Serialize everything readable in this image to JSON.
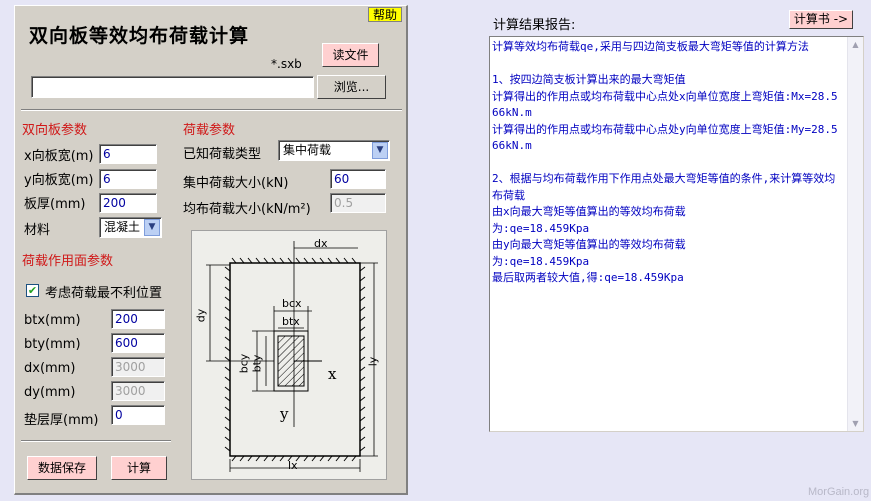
{
  "help_label": "帮助",
  "app_title": "双向板等效均布荷载计算",
  "file": {
    "extension": "*.sxb",
    "read_button": "读文件",
    "browse_button": "浏览...",
    "path_value": ""
  },
  "plate_params": {
    "title": "双向板参数",
    "x_width_label": "x向板宽(m)",
    "x_width_value": "6",
    "y_width_label": "y向板宽(m)",
    "y_width_value": "6",
    "thickness_label": "板厚(mm)",
    "thickness_value": "200",
    "material_label": "材料",
    "material_value": "混凝土"
  },
  "load_params": {
    "title": "荷载参数",
    "known_type_label": "已知荷载类型",
    "known_type_value": "集中荷载",
    "concentrated_label": "集中荷载大小(kN)",
    "concentrated_value": "60",
    "distributed_label": "均布荷载大小(kN/m²)",
    "distributed_value": "0.5"
  },
  "surface_params": {
    "title": "荷载作用面参数",
    "worst_position_label": "考虑荷载最不利位置",
    "worst_position_checked": true,
    "btx_label": "btx(mm)",
    "btx_value": "200",
    "bty_label": "bty(mm)",
    "bty_value": "600",
    "dx_label": "dx(mm)",
    "dx_value": "3000",
    "dy_label": "dy(mm)",
    "dy_value": "3000",
    "cushion_label": "垫层厚(mm)",
    "cushion_value": "0"
  },
  "diagram": {
    "dx": "dx",
    "dy": "dy",
    "bcx": "bcx",
    "btx": "btx",
    "bcy": "bcy",
    "bty": "bty",
    "lx": "lx",
    "ly": "ly",
    "x": "x",
    "y": "y"
  },
  "buttons": {
    "save": "数据保存",
    "calc": "计算"
  },
  "report": {
    "label": "计算结果报告:",
    "book_button": "计算书 ->",
    "text": "计算等效均布荷载qe,采用与四边简支板最大弯矩等值的计算方法\n\n1、按四边简支板计算出来的最大弯矩值\n计算得出的作用点或均布荷载中心点处x向单位宽度上弯矩值:Mx=28.566kN.m\n计算得出的作用点或均布荷载中心点处y向单位宽度上弯矩值:My=28.566kN.m\n\n2、根据与均布荷载作用下作用点处最大弯矩等值的条件,来计算等效均布荷载\n由x向最大弯矩等值算出的等效均布荷载\n为:qe=18.459Kpa\n由y向最大弯矩等值算出的等效均布荷载\n为:qe=18.459Kpa\n最后取两者较大值,得:qe=18.459Kpa"
  },
  "watermark": "MorGain.org",
  "colors": {
    "section_title": "#d01818",
    "input_text": "#0000a0",
    "report_text": "#0000c0",
    "help_bg": "#ffff00",
    "button_pink": "#ffd0d0"
  }
}
